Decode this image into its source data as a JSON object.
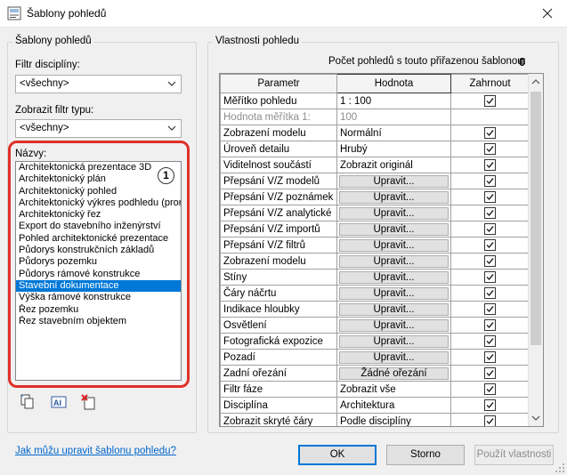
{
  "window": {
    "title": "Šablony pohledů"
  },
  "left": {
    "group_label": "Šablony pohledů",
    "discipline_filter_label": "Filtr disciplíny:",
    "discipline_filter_value": "<všechny>",
    "type_filter_label": "Zobrazit filtr typu:",
    "type_filter_value": "<všechny>",
    "names_label": "Názvy:",
    "badge": "1",
    "names": [
      "Architektonická prezentace 3D",
      "Architektonický plán",
      "Architektonický pohled",
      "Architektonický výkres podhledu (pror",
      "Architektonický řez",
      "Export do stavebního inženýrství",
      "Pohled architektonické prezentace",
      "Půdorys konstrukčních základů",
      "Půdorys pozemku",
      "Půdorys rámové konstrukce",
      "Stavební dokumentace",
      "Výška rámové konstrukce",
      "Řez pozemku",
      "Řez stavebním objektem"
    ],
    "selected_index": 10
  },
  "right": {
    "group_label": "Vlastnosti pohledu",
    "count_label": "Počet pohledů s touto přiřazenou šablonou:",
    "count_value": "0",
    "columns": [
      "Parametr",
      "Hodnota",
      "Zahrnout"
    ],
    "rows": [
      {
        "param": "Měřítko pohledu",
        "value": "1 : 100",
        "kind": "text",
        "include": true
      },
      {
        "param": "Hodnota měřítka    1:",
        "value": "100",
        "kind": "dim",
        "include": null
      },
      {
        "param": "Zobrazení modelu",
        "value": "Normální",
        "kind": "text",
        "include": true
      },
      {
        "param": "Úroveň detailu",
        "value": "Hrubý",
        "kind": "text",
        "include": true
      },
      {
        "param": "Viditelnost součástí",
        "value": "Zobrazit originál",
        "kind": "text",
        "include": true
      },
      {
        "param": "Přepsání V/Z modelů",
        "value": "Upravit...",
        "kind": "button",
        "include": true
      },
      {
        "param": "Přepsání V/Z poznámek",
        "value": "Upravit...",
        "kind": "button",
        "include": true
      },
      {
        "param": "Přepsání V/Z analytické",
        "value": "Upravit...",
        "kind": "button",
        "include": true
      },
      {
        "param": "Přepsání V/Z importů",
        "value": "Upravit...",
        "kind": "button",
        "include": true
      },
      {
        "param": "Přepsání V/Z filtrů",
        "value": "Upravit...",
        "kind": "button",
        "include": true
      },
      {
        "param": "Zobrazení modelu",
        "value": "Upravit...",
        "kind": "button",
        "include": true
      },
      {
        "param": "Stíny",
        "value": "Upravit...",
        "kind": "button",
        "include": true
      },
      {
        "param": "Čáry náčrtu",
        "value": "Upravit...",
        "kind": "button",
        "include": true
      },
      {
        "param": "Indikace hloubky",
        "value": "Upravit...",
        "kind": "button",
        "include": true
      },
      {
        "param": "Osvětlení",
        "value": "Upravit...",
        "kind": "button",
        "include": true
      },
      {
        "param": "Fotografická expozice",
        "value": "Upravit...",
        "kind": "button",
        "include": true
      },
      {
        "param": "Pozadí",
        "value": "Upravit...",
        "kind": "button",
        "include": true
      },
      {
        "param": "Zadní ořezání",
        "value": "Žádné ořezání",
        "kind": "button",
        "include": true
      },
      {
        "param": "Filtr fáze",
        "value": "Zobrazit vše",
        "kind": "text",
        "include": true
      },
      {
        "param": "Disciplína",
        "value": "Architektura",
        "kind": "text",
        "include": true
      },
      {
        "param": "Zobrazit skryté čáry",
        "value": "Podle disciplíny",
        "kind": "text",
        "include": true
      }
    ]
  },
  "footer": {
    "help_link": "Jak můžu upravit šablonu pohledu?",
    "ok_label": "OK",
    "cancel_label": "Storno",
    "apply_label": "Použít vlastnosti"
  },
  "colors": {
    "selection": "#0078d7",
    "highlight": "#e0302a",
    "link": "#0066cc"
  }
}
